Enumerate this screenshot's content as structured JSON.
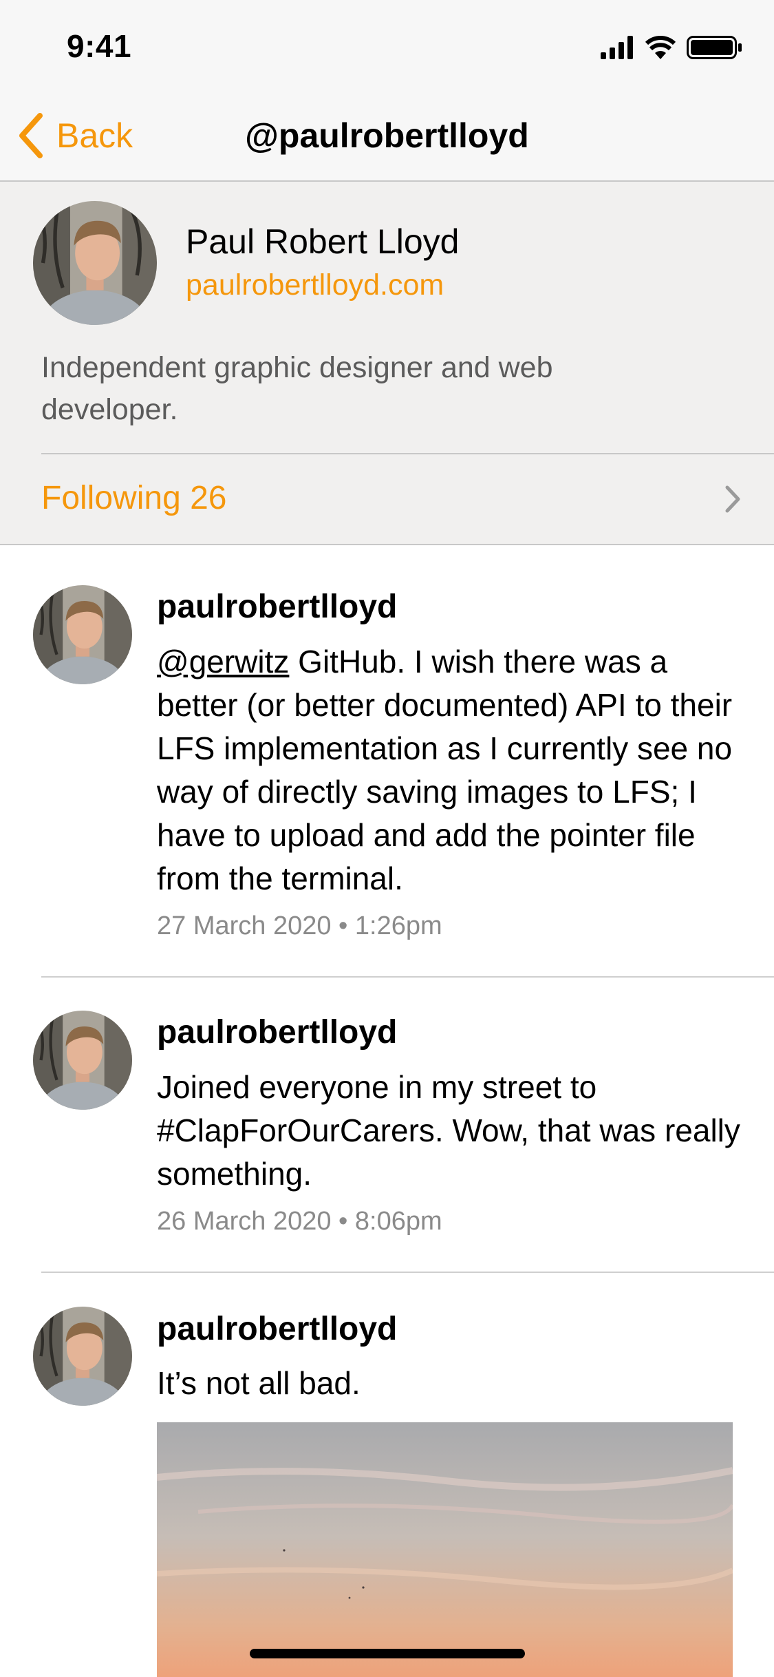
{
  "status_bar": {
    "time": "9:41"
  },
  "nav": {
    "back_label": "Back",
    "title": "@paulrobertlloyd"
  },
  "profile": {
    "name": "Paul Robert Lloyd",
    "website": "paulrobertlloyd.com",
    "bio": "Independent graphic designer and web developer.",
    "following_label": "Following 26"
  },
  "colors": {
    "accent": "#f5970c",
    "profile_bg": "#f1f0ef",
    "muted_text": "#8a8a8a"
  },
  "icons": [
    "signal-icon",
    "wifi-icon",
    "battery-icon",
    "chevron-left-icon",
    "chevron-right-icon"
  ],
  "posts": [
    {
      "author": "paulrobertlloyd",
      "mention": "@gerwitz",
      "text": " GitHub. I wish there was a better (or better documented) API to their LFS implementation as I currently see no way of directly saving images to LFS; I have to upload and add the pointer file from the terminal.",
      "date": "27 March 2020 • 1:26pm"
    },
    {
      "author": "paulrobertlloyd",
      "text": "Joined everyone in my street to #ClapForOurCarers. Wow, that was really something.",
      "date": "26 March 2020 • 8:06pm"
    },
    {
      "author": "paulrobertlloyd",
      "text": "It’s not all bad."
    }
  ]
}
